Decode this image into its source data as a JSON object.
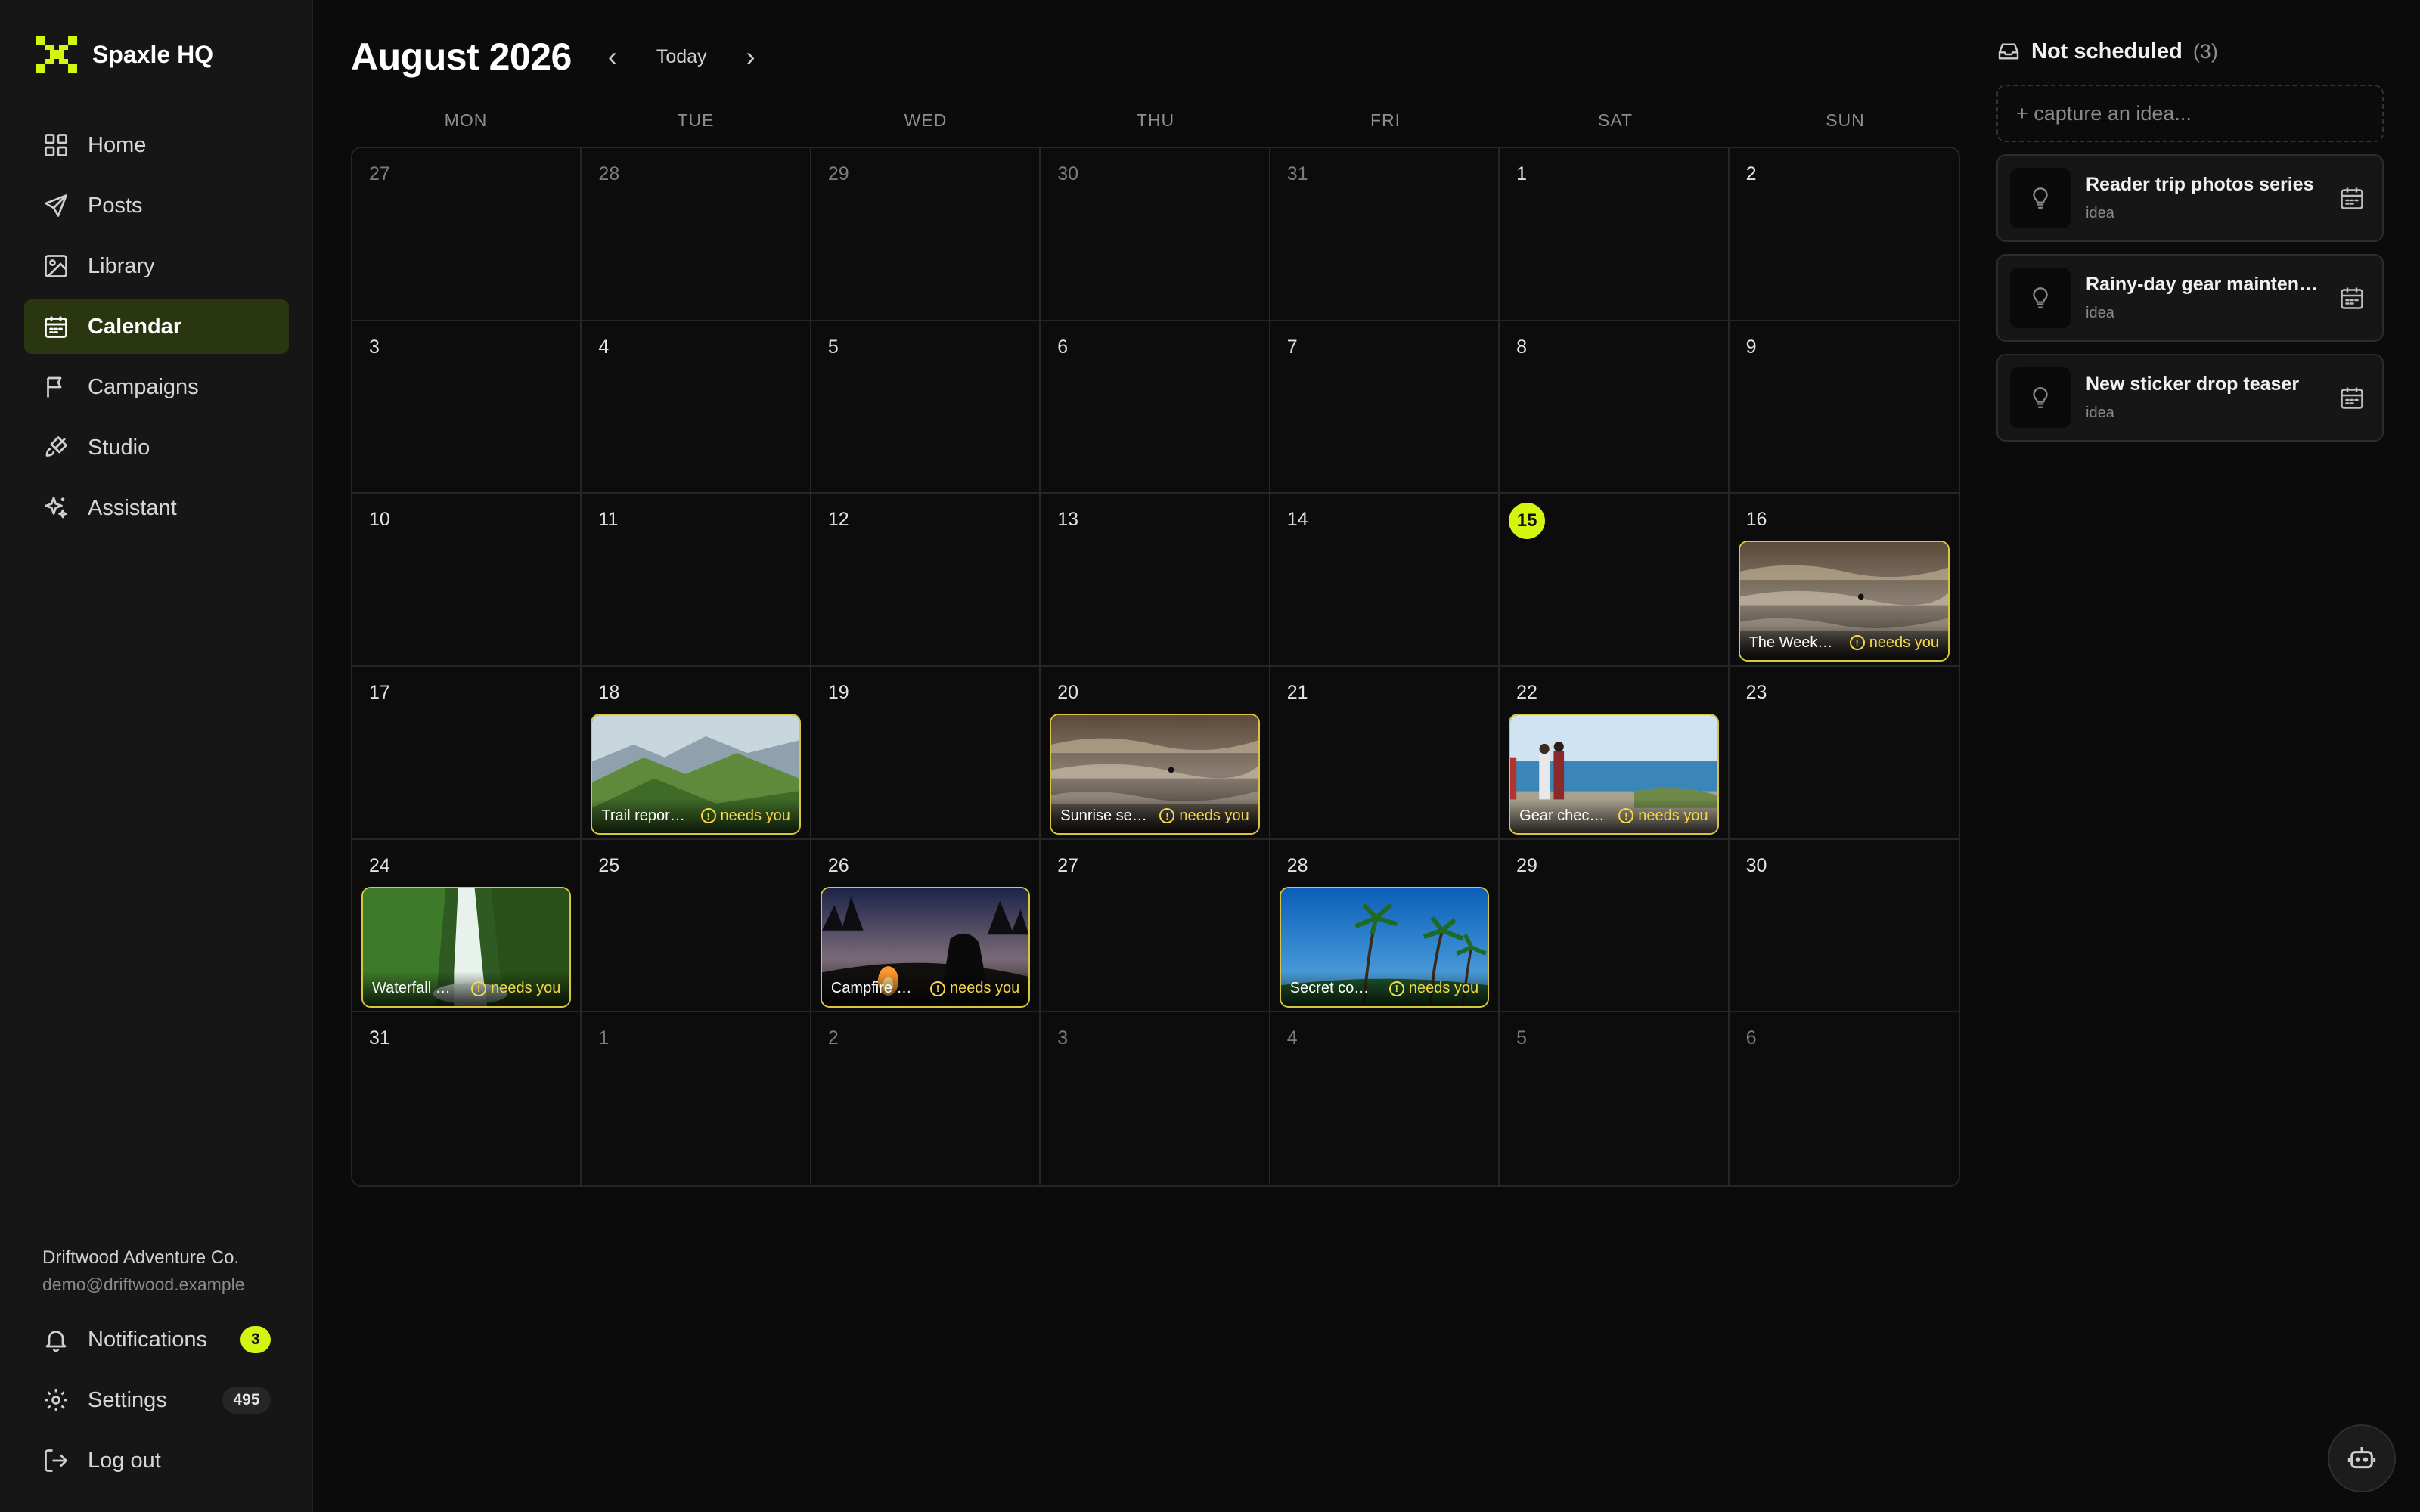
{
  "app": {
    "name": "Spaxle HQ"
  },
  "nav": {
    "items": [
      {
        "label": "Home",
        "icon": "home-grid-icon"
      },
      {
        "label": "Posts",
        "icon": "send-icon"
      },
      {
        "label": "Library",
        "icon": "image-icon"
      },
      {
        "label": "Calendar",
        "icon": "calendar-icon",
        "active": true
      },
      {
        "label": "Campaigns",
        "icon": "flag-icon"
      },
      {
        "label": "Studio",
        "icon": "brush-icon"
      },
      {
        "label": "Assistant",
        "icon": "sparkles-icon"
      }
    ]
  },
  "account": {
    "name": "Driftwood Adventure Co.",
    "email": "demo@driftwood.example"
  },
  "bottom_nav": {
    "notifications": {
      "label": "Notifications",
      "badge": "3"
    },
    "settings": {
      "label": "Settings",
      "badge": "495"
    },
    "logout": {
      "label": "Log out"
    }
  },
  "calendar": {
    "title": "August 2026",
    "prev": "‹",
    "next": "›",
    "today_label": "Today",
    "weekdays": [
      "MON",
      "TUE",
      "WED",
      "THU",
      "FRI",
      "SAT",
      "SUN"
    ],
    "days": [
      {
        "n": "27",
        "muted": true
      },
      {
        "n": "28",
        "muted": true
      },
      {
        "n": "29",
        "muted": true
      },
      {
        "n": "30",
        "muted": true
      },
      {
        "n": "31",
        "muted": true
      },
      {
        "n": "1"
      },
      {
        "n": "2"
      },
      {
        "n": "3"
      },
      {
        "n": "4"
      },
      {
        "n": "5"
      },
      {
        "n": "6"
      },
      {
        "n": "7"
      },
      {
        "n": "8"
      },
      {
        "n": "9"
      },
      {
        "n": "10"
      },
      {
        "n": "11"
      },
      {
        "n": "12"
      },
      {
        "n": "13"
      },
      {
        "n": "14"
      },
      {
        "n": "15",
        "today": true
      },
      {
        "n": "16",
        "event": {
          "title": "The Week…",
          "flag": "needs you",
          "scene": "surf"
        }
      },
      {
        "n": "17"
      },
      {
        "n": "18",
        "event": {
          "title": "Trail repor…",
          "flag": "needs you",
          "scene": "mountain"
        }
      },
      {
        "n": "19"
      },
      {
        "n": "20",
        "event": {
          "title": "Sunrise se…",
          "flag": "needs you",
          "scene": "surf"
        }
      },
      {
        "n": "21"
      },
      {
        "n": "22",
        "event": {
          "title": "Gear chec…",
          "flag": "needs you",
          "scene": "beach-people"
        }
      },
      {
        "n": "23"
      },
      {
        "n": "24",
        "event": {
          "title": "Waterfall …",
          "flag": "needs you",
          "scene": "waterfall"
        }
      },
      {
        "n": "25"
      },
      {
        "n": "26",
        "event": {
          "title": "Campfire …",
          "flag": "needs you",
          "scene": "campfire"
        }
      },
      {
        "n": "27"
      },
      {
        "n": "28",
        "event": {
          "title": "Secret co…",
          "flag": "needs you",
          "scene": "palms"
        }
      },
      {
        "n": "29"
      },
      {
        "n": "30"
      },
      {
        "n": "31"
      },
      {
        "n": "1",
        "muted": true
      },
      {
        "n": "2",
        "muted": true
      },
      {
        "n": "3",
        "muted": true
      },
      {
        "n": "4",
        "muted": true
      },
      {
        "n": "5",
        "muted": true
      },
      {
        "n": "6",
        "muted": true
      }
    ]
  },
  "unscheduled": {
    "title": "Not scheduled",
    "count": "(3)",
    "capture_placeholder": "+ capture an idea...",
    "ideas": [
      {
        "title": "Reader trip photos series",
        "tag": "idea"
      },
      {
        "title": "Rainy-day gear mainten…",
        "tag": "idea"
      },
      {
        "title": "New sticker drop teaser",
        "tag": "idea"
      }
    ]
  },
  "colors": {
    "accent": "#d4f510",
    "warning": "#f5d84a",
    "active_nav_bg": "#2a3610",
    "background": "#0b0b0b"
  }
}
